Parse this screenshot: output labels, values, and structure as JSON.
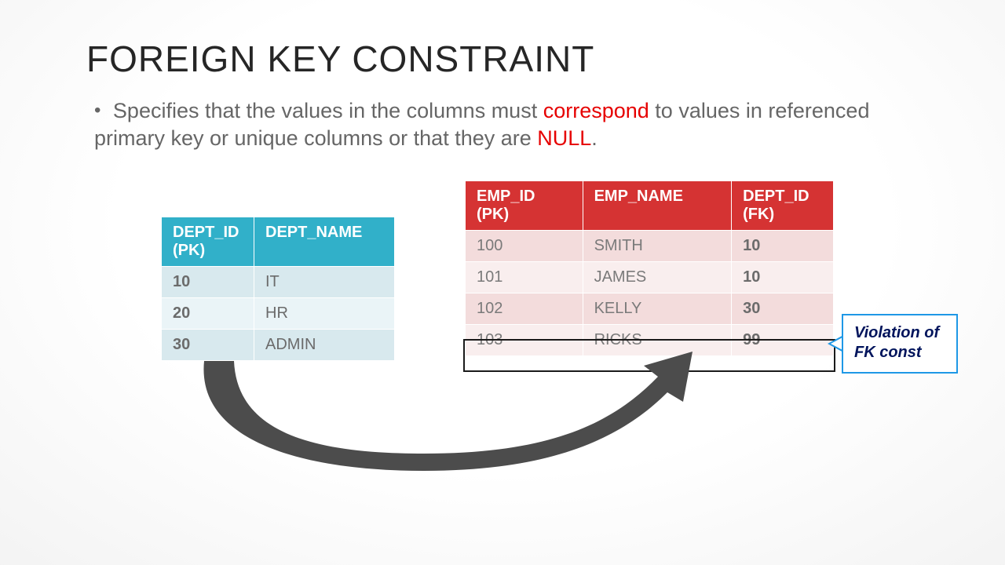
{
  "title": "FOREIGN KEY CONSTRAINT",
  "bullet": {
    "pre": "Specifies that the values in the columns must ",
    "hl1": "correspond",
    "mid": " to values in referenced primary key or unique columns or that they are ",
    "hl2": "NULL",
    "post": "."
  },
  "dept_table": {
    "headers": [
      "DEPT_ID (PK)",
      "DEPT_NAME"
    ],
    "rows": [
      {
        "id": "10",
        "name": "IT"
      },
      {
        "id": "20",
        "name": "HR"
      },
      {
        "id": "30",
        "name": "ADMIN"
      }
    ]
  },
  "emp_table": {
    "headers": [
      "EMP_ID (PK)",
      "EMP_NAME",
      "DEPT_ID (FK)"
    ],
    "rows": [
      {
        "id": "100",
        "name": "SMITH",
        "dept": "10"
      },
      {
        "id": "101",
        "name": "JAMES",
        "dept": "10"
      },
      {
        "id": "102",
        "name": "KELLY",
        "dept": "30"
      },
      {
        "id": "103",
        "name": "RICKS",
        "dept": "99"
      }
    ]
  },
  "callout": {
    "line1": "Violation of",
    "line2": "FK const"
  }
}
